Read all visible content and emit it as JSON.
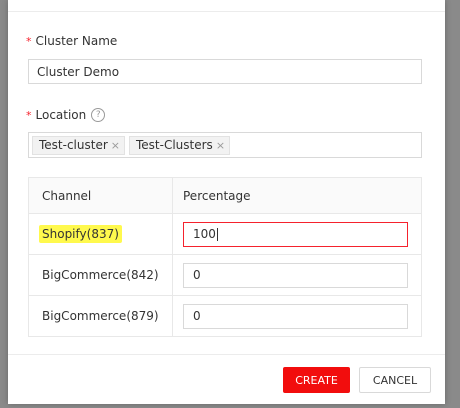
{
  "form": {
    "cluster_name": {
      "label": "Cluster Name",
      "required_mark": "*",
      "value": "Cluster Demo"
    },
    "location": {
      "label": "Location",
      "required_mark": "*",
      "help_icon": "question-circle-icon",
      "tags": [
        "Test-cluster",
        "Test-Clusters"
      ],
      "tag_close_glyph": "×"
    },
    "table": {
      "headers": [
        "Channel",
        "Percentage"
      ],
      "rows": [
        {
          "channel": "Shopify(837)",
          "percentage": "100",
          "highlighted": true,
          "active": true
        },
        {
          "channel": "BigCommerce(842)",
          "percentage": "0",
          "highlighted": false,
          "active": false
        },
        {
          "channel": "BigCommerce(879)",
          "percentage": "0",
          "highlighted": false,
          "active": false
        }
      ]
    }
  },
  "footer": {
    "create_label": "CREATE",
    "cancel_label": "CANCEL"
  },
  "colors": {
    "accent": "#f20d0d",
    "required": "#f5222d",
    "highlight": "#fff94d"
  }
}
